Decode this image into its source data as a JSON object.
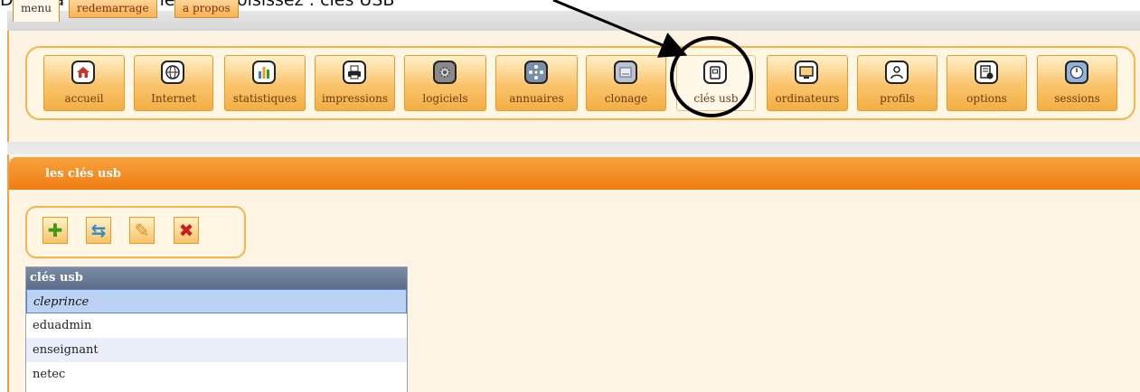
{
  "caption": "Dans la barre de menus, choisissez : clés USB",
  "tabs": [
    {
      "label": "menu",
      "active": true
    },
    {
      "label": "redemarrage",
      "active": false
    },
    {
      "label": "a propos",
      "active": false
    }
  ],
  "menu": [
    {
      "label": "accueil",
      "icon": "home-icon"
    },
    {
      "label": "Internet",
      "icon": "globe-icon"
    },
    {
      "label": "statistiques",
      "icon": "bar-chart-icon"
    },
    {
      "label": "impressions",
      "icon": "printer-icon"
    },
    {
      "label": "logiciels",
      "icon": "gear-icon"
    },
    {
      "label": "annuaires",
      "icon": "network-icon"
    },
    {
      "label": "clonage",
      "icon": "disk-icon"
    },
    {
      "label": "clés usb",
      "icon": "usb-key-icon",
      "selected": true
    },
    {
      "label": "ordinateurs",
      "icon": "monitor-icon"
    },
    {
      "label": "profils",
      "icon": "user-icon"
    },
    {
      "label": "options",
      "icon": "options-icon"
    },
    {
      "label": "sessions",
      "icon": "timer-icon"
    }
  ],
  "section": {
    "title": "les clés usb"
  },
  "toolbar": [
    {
      "icon": "add-icon",
      "color": "#3a9a1a"
    },
    {
      "icon": "refresh-icon",
      "color": "#2f8ac8"
    },
    {
      "icon": "edit-icon",
      "color": "#d9881b"
    },
    {
      "icon": "delete-icon",
      "color": "#c81e1e"
    }
  ],
  "list": {
    "header": "clés usb",
    "items": [
      "cleprince",
      "eduadmin",
      "enseignant",
      "netec"
    ],
    "selected": "cleprince"
  },
  "colors": {
    "accent": "#ef7d12",
    "panel": "#fff6e4",
    "border": "#f5b549"
  }
}
